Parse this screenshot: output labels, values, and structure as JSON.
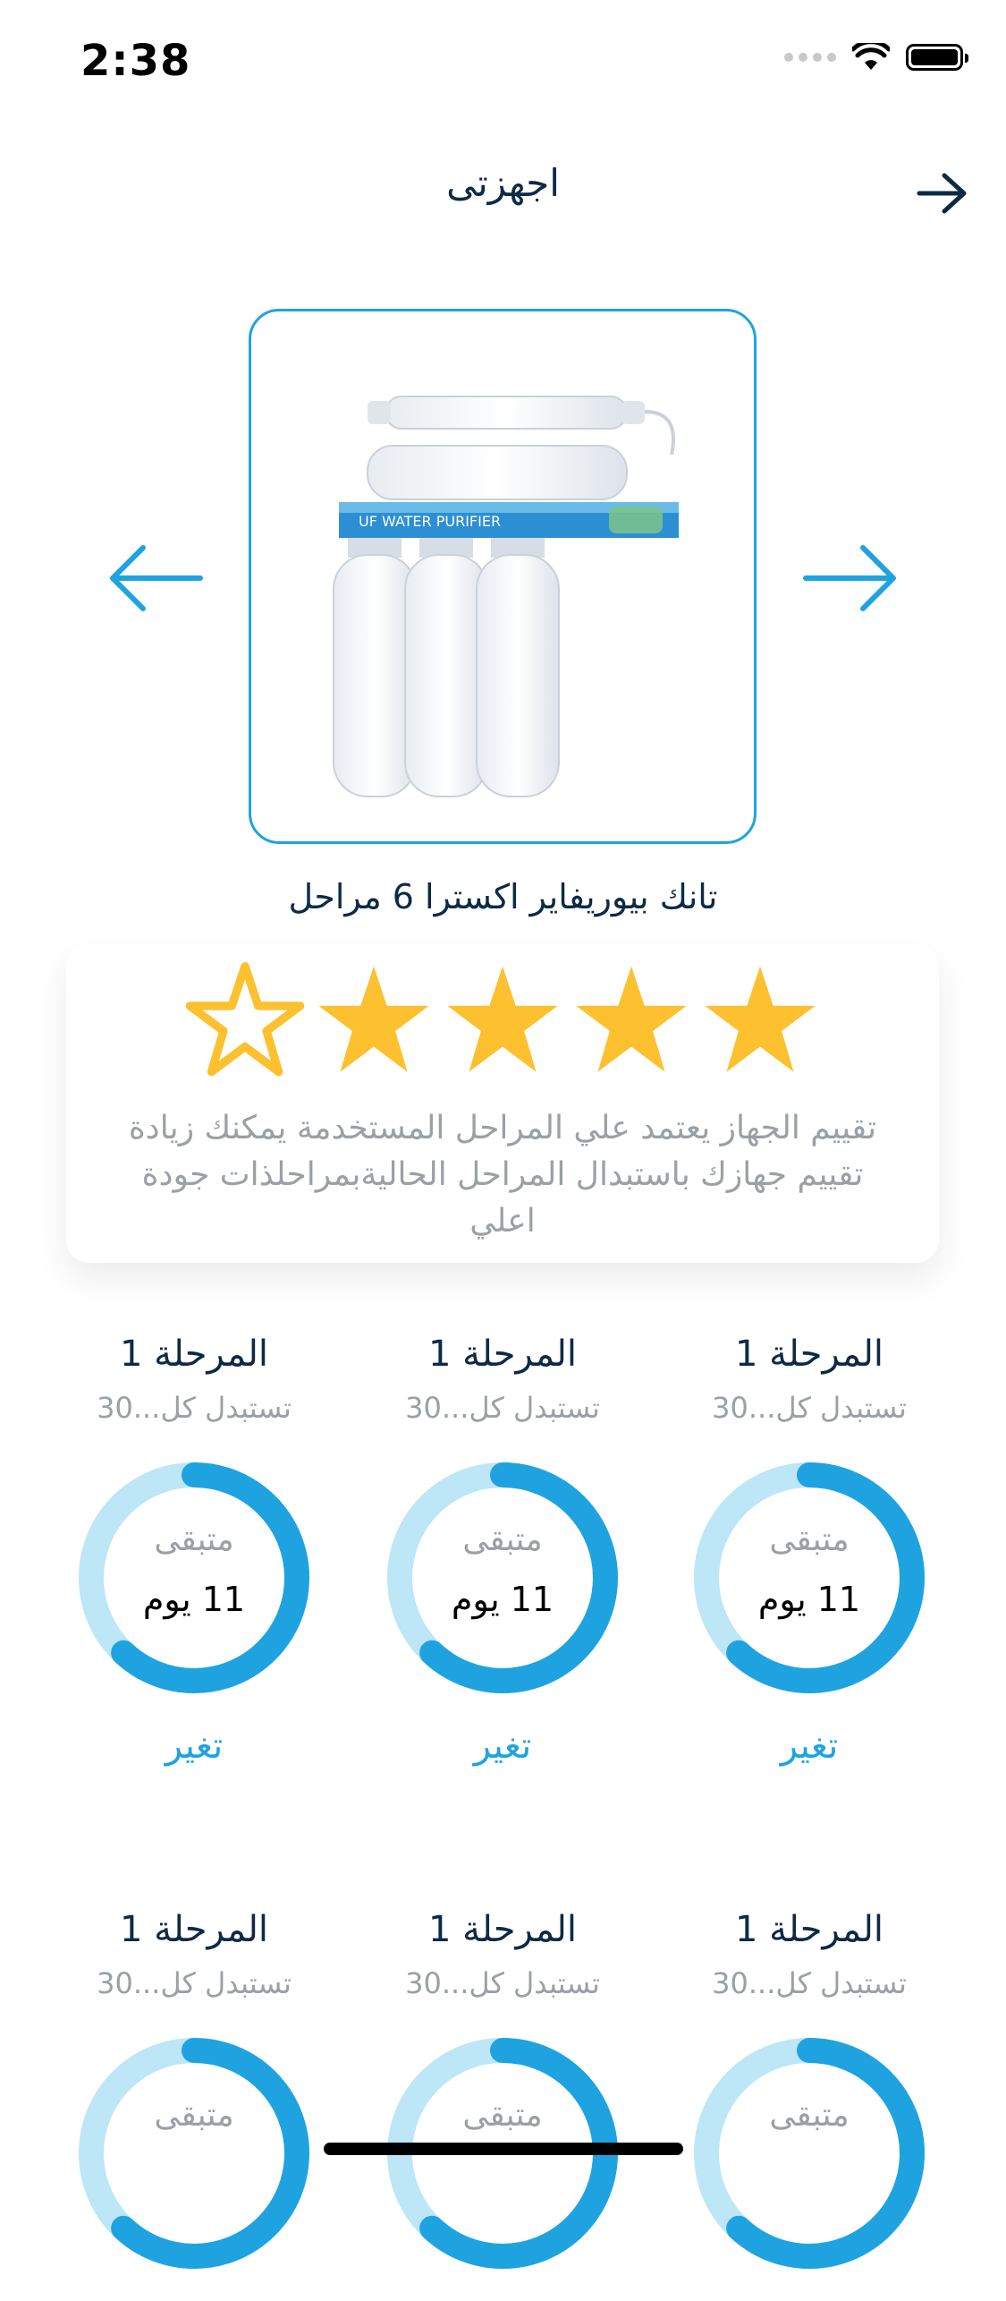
{
  "status_bar": {
    "time": "2:38"
  },
  "header": {
    "title": "اجهزتى"
  },
  "product": {
    "name": "تانك بيوريفاير اكسترا 6 مراحل",
    "image_label": "UF WATER PURIFIER"
  },
  "rating": {
    "value": 4,
    "max": 5,
    "text": "تقييم الجهاز يعتمد علي المراحل المستخدمة يمكنك زيادة تقييم جهازك باستبدال المراحل الحاليةبمراحلذات جودة اعلي"
  },
  "colors": {
    "accent": "#1fa3e0",
    "ring_track": "#bde6f7",
    "star": "#fdc02f",
    "title": "#0d2a45"
  },
  "stages": [
    {
      "title": "المرحلة 1",
      "subtitle": "تستبدل كل...30",
      "remaining_label": "متبقى",
      "remaining_value": "11 يوم",
      "action": "تغير",
      "progress": 0.62
    },
    {
      "title": "المرحلة 1",
      "subtitle": "تستبدل كل...30",
      "remaining_label": "متبقى",
      "remaining_value": "11 يوم",
      "action": "تغير",
      "progress": 0.62
    },
    {
      "title": "المرحلة 1",
      "subtitle": "تستبدل كل...30",
      "remaining_label": "متبقى",
      "remaining_value": "11 يوم",
      "action": "تغير",
      "progress": 0.62
    },
    {
      "title": "المرحلة 1",
      "subtitle": "تستبدل كل...30",
      "remaining_label": "متبقى",
      "remaining_value": "",
      "action": "",
      "progress": 0.62
    },
    {
      "title": "المرحلة 1",
      "subtitle": "تستبدل كل...30",
      "remaining_label": "متبقى",
      "remaining_value": "",
      "action": "",
      "progress": 0.62
    },
    {
      "title": "المرحلة 1",
      "subtitle": "تستبدل كل...30",
      "remaining_label": "متبقى",
      "remaining_value": "",
      "action": "",
      "progress": 0.62
    }
  ]
}
